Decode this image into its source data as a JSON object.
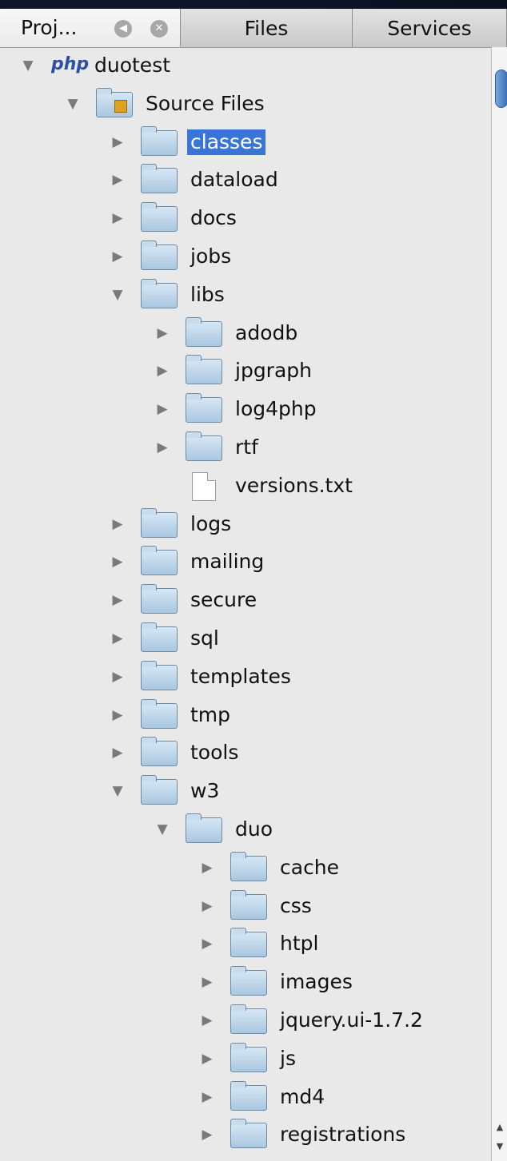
{
  "tabs": [
    {
      "label": "Proj...",
      "active": true
    },
    {
      "label": "Files",
      "active": false
    },
    {
      "label": "Services",
      "active": false
    }
  ],
  "tab_controls": {
    "minimize_icon": "minimize-icon",
    "close_icon": "close-icon"
  },
  "tree": [
    {
      "label": "duotest",
      "type": "php-project",
      "expanded": true,
      "depth": 0
    },
    {
      "label": "Source Files",
      "type": "source-folder",
      "expanded": true,
      "depth": 1
    },
    {
      "label": "classes",
      "type": "folder",
      "expanded": false,
      "depth": 2,
      "selected": true
    },
    {
      "label": "dataload",
      "type": "folder",
      "expanded": false,
      "depth": 2
    },
    {
      "label": "docs",
      "type": "folder",
      "expanded": false,
      "depth": 2
    },
    {
      "label": "jobs",
      "type": "folder",
      "expanded": false,
      "depth": 2
    },
    {
      "label": "libs",
      "type": "folder",
      "expanded": true,
      "depth": 2
    },
    {
      "label": "adodb",
      "type": "folder",
      "expanded": false,
      "depth": 3
    },
    {
      "label": "jpgraph",
      "type": "folder",
      "expanded": false,
      "depth": 3
    },
    {
      "label": "log4php",
      "type": "folder",
      "expanded": false,
      "depth": 3
    },
    {
      "label": "rtf",
      "type": "folder",
      "expanded": false,
      "depth": 3
    },
    {
      "label": "versions.txt",
      "type": "file",
      "depth": 3
    },
    {
      "label": "logs",
      "type": "folder",
      "expanded": false,
      "depth": 2
    },
    {
      "label": "mailing",
      "type": "folder",
      "expanded": false,
      "depth": 2
    },
    {
      "label": "secure",
      "type": "folder",
      "expanded": false,
      "depth": 2
    },
    {
      "label": "sql",
      "type": "folder",
      "expanded": false,
      "depth": 2
    },
    {
      "label": "templates",
      "type": "folder",
      "expanded": false,
      "depth": 2
    },
    {
      "label": "tmp",
      "type": "folder",
      "expanded": false,
      "depth": 2
    },
    {
      "label": "tools",
      "type": "folder",
      "expanded": false,
      "depth": 2
    },
    {
      "label": "w3",
      "type": "folder",
      "expanded": true,
      "depth": 2
    },
    {
      "label": "duo",
      "type": "folder",
      "expanded": true,
      "depth": 3
    },
    {
      "label": "cache",
      "type": "folder",
      "expanded": false,
      "depth": 4
    },
    {
      "label": "css",
      "type": "folder",
      "expanded": false,
      "depth": 4
    },
    {
      "label": "htpl",
      "type": "folder",
      "expanded": false,
      "depth": 4
    },
    {
      "label": "images",
      "type": "folder",
      "expanded": false,
      "depth": 4
    },
    {
      "label": "jquery.ui-1.7.2",
      "type": "folder",
      "expanded": false,
      "depth": 4
    },
    {
      "label": "js",
      "type": "folder",
      "expanded": false,
      "depth": 4
    },
    {
      "label": "md4",
      "type": "folder",
      "expanded": false,
      "depth": 4
    },
    {
      "label": "registrations",
      "type": "folder",
      "expanded": false,
      "depth": 4
    }
  ],
  "php_logo_text": "php"
}
